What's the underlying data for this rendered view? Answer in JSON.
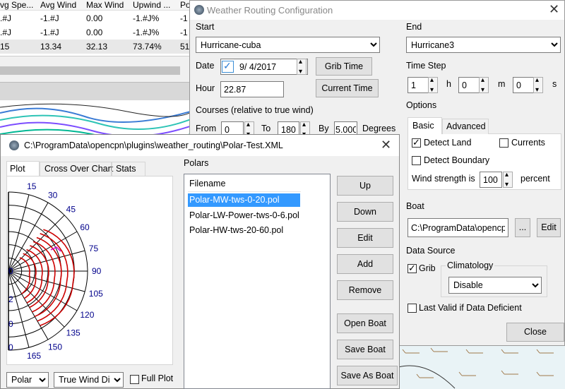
{
  "bg_table": {
    "headers": [
      "vg Spe...",
      "Avg Wind",
      "Max Wind",
      "Upwind ...",
      "Po"
    ],
    "rows": [
      [
        ".#J",
        "-1.#J",
        "0.00",
        "-1.#J%",
        "-1"
      ],
      [
        ".#J",
        "-1.#J",
        "0.00",
        "-1.#J%",
        "-1"
      ],
      [
        "15",
        "13.34",
        "32.13",
        "73.74%",
        "51"
      ]
    ]
  },
  "config": {
    "title": "Weather Routing Configuration",
    "start_label": "Start",
    "start_value": "Hurricane-cuba",
    "date_label": "Date",
    "date_value": "9/  4/2017",
    "grib_time": "Grib Time",
    "hour_label": "Hour",
    "hour_value": "22.87",
    "current_time": "Current Time",
    "courses_label": "Courses (relative to true wind)",
    "from_label": "From",
    "from_value": "0",
    "to_label": "To",
    "to_value": "180",
    "by_label": "By",
    "by_value": "5.000",
    "degrees_label": "Degrees",
    "end_label": "End",
    "end_value": "Hurricane3",
    "timestep_label": "Time Step",
    "ts_h_value": "1",
    "ts_h_unit": "h",
    "ts_m_value": "0",
    "ts_m_unit": "m",
    "ts_s_value": "0",
    "ts_s_unit": "s",
    "options_label": "Options",
    "tab_basic": "Basic",
    "tab_advanced": "Advanced",
    "detect_land": "Detect Land",
    "currents": "Currents",
    "detect_boundary": "Detect Boundary",
    "wind_strength_label": "Wind strength is",
    "wind_strength_value": "100",
    "percent_label": "percent",
    "boat_label": "Boat",
    "boat_value": "C:\\ProgramData\\opencpn",
    "boat_browse": "...",
    "boat_edit": "Edit",
    "datasource_label": "Data Source",
    "grib_label": "Grib",
    "climatology_label": "Climatology",
    "climatology_value": "Disable",
    "last_valid": "Last Valid if Data Deficient",
    "close": "Close"
  },
  "polar": {
    "title": "C:\\ProgramData\\opencpn\\plugins\\weather_routing\\Polar-Test.XML",
    "tabs": [
      "Plot",
      "Cross Over Chart",
      "Stats"
    ],
    "angle_labels": [
      "15",
      "30",
      "45",
      "60",
      "75",
      "90",
      "105",
      "120",
      "135",
      "150",
      "165"
    ],
    "radius_labels": [
      "0",
      "2",
      "0",
      "0"
    ],
    "polars_label": "Polars",
    "filename_header": "Filename",
    "files": [
      "Polar-MW-tws-0-20.pol",
      "Polar-LW-Power-tws-0-6.pol",
      "Polar-HW-tws-20-60.pol"
    ],
    "buttons": {
      "up": "Up",
      "down": "Down",
      "edit": "Edit",
      "add": "Add",
      "remove": "Remove",
      "open_boat": "Open Boat",
      "save_boat": "Save Boat",
      "save_as_boat": "Save As Boat"
    },
    "plot_type": "Polar",
    "plot_var": "True Wind Dir",
    "full_plot": "Full Plot"
  },
  "colors": {
    "selection": "#3399ff",
    "polar_curve": "#cc0000",
    "window_bg": "#f0f0f0"
  }
}
